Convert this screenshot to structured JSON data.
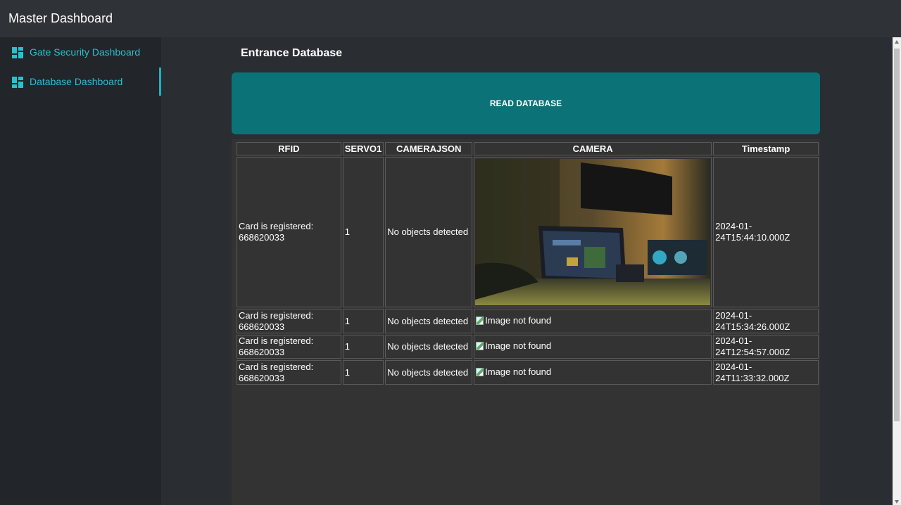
{
  "app": {
    "title": "Master Dashboard"
  },
  "sidebar": {
    "items": [
      {
        "label": "Gate Security Dashboard",
        "icon": "dashboard-icon",
        "active": false
      },
      {
        "label": "Database Dashboard",
        "icon": "dashboard-icon",
        "active": true
      }
    ]
  },
  "main": {
    "section_title": "Entrance Database",
    "read_button": "READ DATABASE",
    "table": {
      "headers": [
        "RFID",
        "SERVO1",
        "CAMERAJSON",
        "CAMERA",
        "Timestamp"
      ],
      "rows": [
        {
          "rfid": "Card is registered: 668620033",
          "servo": "1",
          "camerajson": "No objects detected",
          "camera": "",
          "timestamp": "2024-01-24T15:44:10.000Z"
        },
        {
          "rfid": "Card is registered: 668620033",
          "servo": "1",
          "camerajson": "No objects detected",
          "camera": "Image not found",
          "timestamp": "2024-01-24T15:34:26.000Z"
        },
        {
          "rfid": "Card is registered: 668620033",
          "servo": "1",
          "camerajson": "No objects detected",
          "camera": "Image not found",
          "timestamp": "2024-01-24T12:54:57.000Z"
        },
        {
          "rfid": "Card is registered: 668620033",
          "servo": "1",
          "camerajson": "No objects detected",
          "camera": "Image not found",
          "timestamp": "2024-01-24T11:33:32.000Z"
        }
      ]
    }
  },
  "colors": {
    "accent": "#2dbfcf",
    "button_bg": "#0b7377",
    "topbar_bg": "#2f3236",
    "sidebar_bg": "#222529",
    "panel_bg": "#333333"
  }
}
